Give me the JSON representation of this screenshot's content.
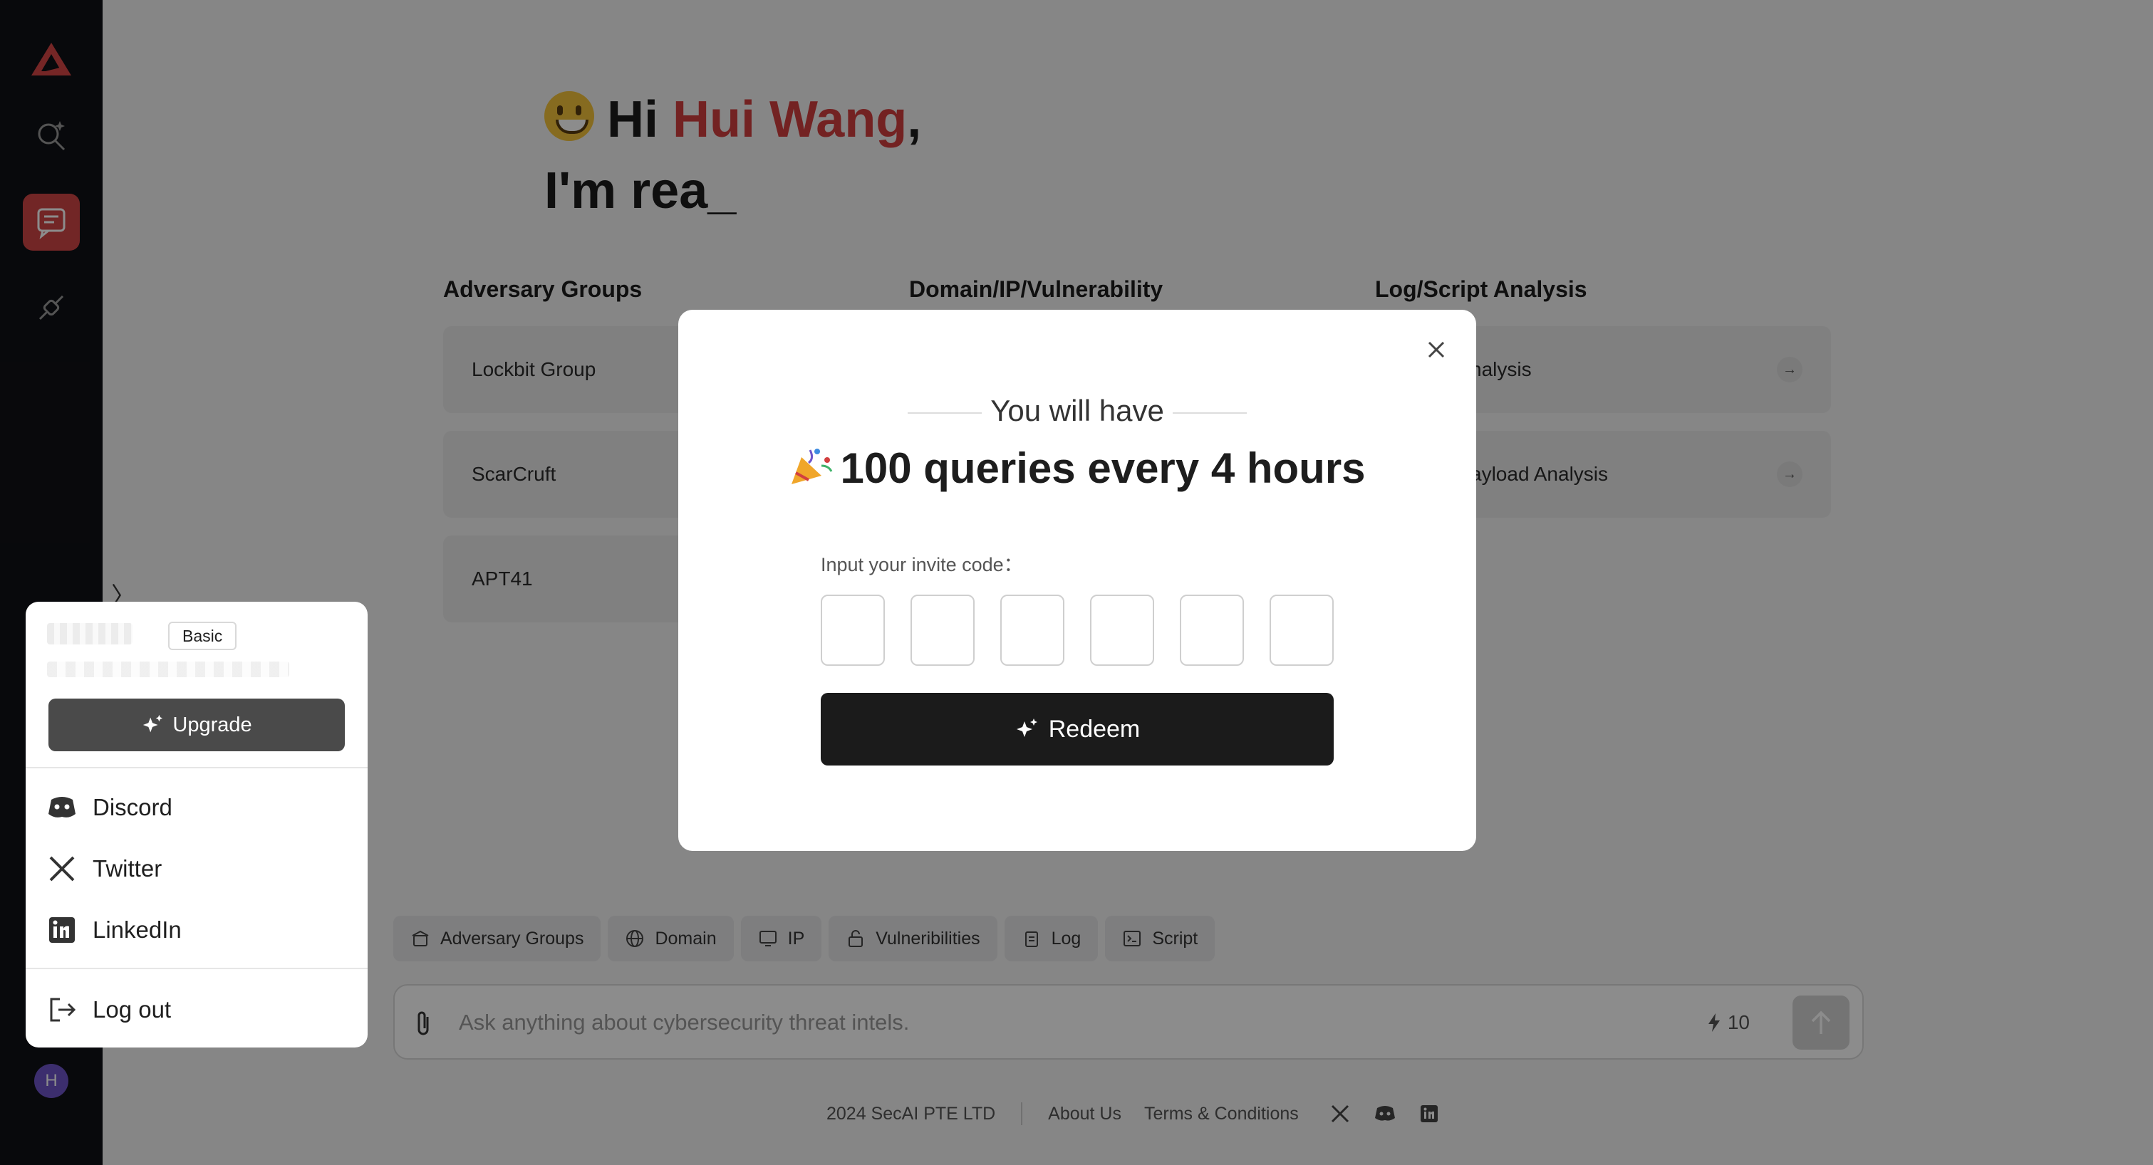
{
  "greeting": {
    "hi": "Hi",
    "name": "Hui Wang",
    "comma": ",",
    "typing": "I'm rea_"
  },
  "categories": [
    {
      "title": "Adversary Groups",
      "items": [
        "Lockbit Group",
        "ScarCruft",
        "APT41"
      ]
    },
    {
      "title": "Domain/IP/Vulnerability",
      "items": []
    },
    {
      "title": "Log/Script Analysis",
      "items": [
        "nalysis",
        "ayload Analysis"
      ]
    }
  ],
  "chips": [
    "Adversary Groups",
    "Domain",
    "IP",
    "Vulneribilities",
    "Log",
    "Script"
  ],
  "ask": {
    "placeholder": "Ask anything about cybersecurity threat intels.",
    "credits": "10"
  },
  "footer": {
    "copyright": "2024 SecAI PTE LTD",
    "about": "About Us",
    "terms": "Terms & Conditions"
  },
  "modal": {
    "subtitle": "You will have",
    "headline": "100 queries every 4 hours",
    "code_label": "Input your invite code：",
    "redeem_label": "Redeem"
  },
  "user_menu": {
    "plan": "Basic",
    "upgrade_label": "Upgrade",
    "links": [
      "Discord",
      "Twitter",
      "LinkedIn"
    ],
    "logout_label": "Log out"
  },
  "avatar_initial": "H",
  "colors": {
    "brand_red": "#d23f3f",
    "sidebar": "#101116",
    "button_dark": "#1b1b1b"
  }
}
